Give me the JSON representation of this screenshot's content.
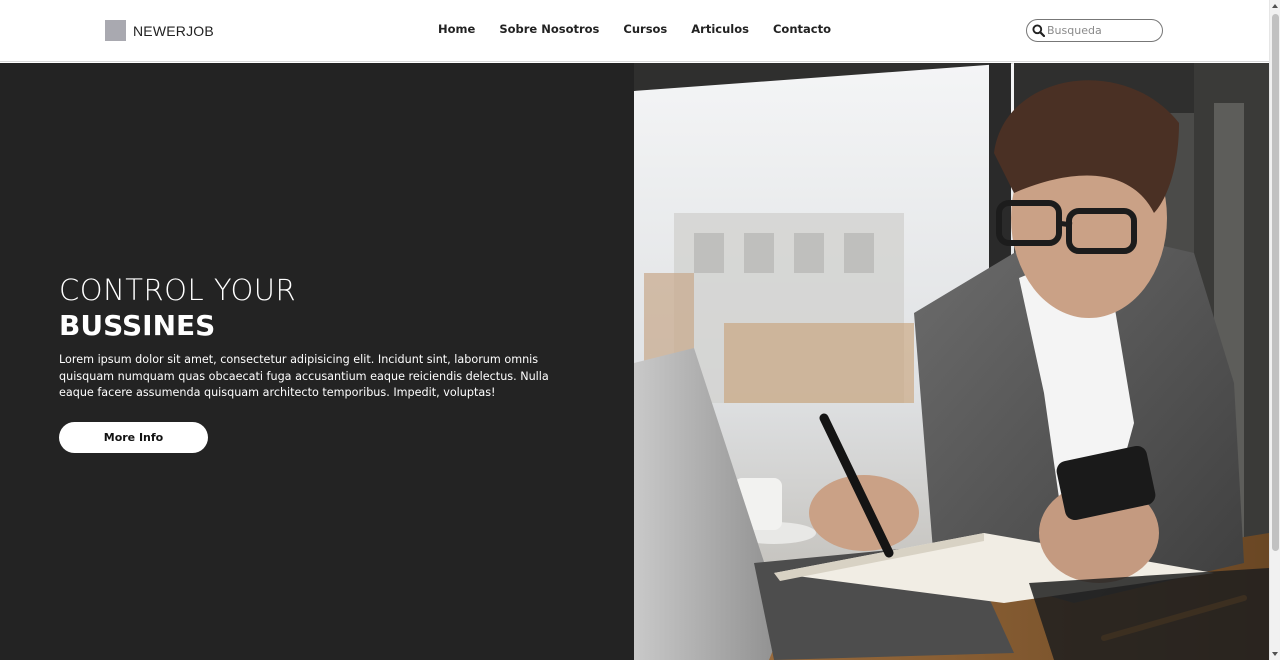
{
  "brand": {
    "name": "NEWERJOB"
  },
  "nav": {
    "items": [
      {
        "label": "Home"
      },
      {
        "label": "Sobre Nosotros"
      },
      {
        "label": "Cursos"
      },
      {
        "label": "Articulos"
      },
      {
        "label": "Contacto"
      }
    ]
  },
  "search": {
    "placeholder": "Busqueda",
    "value": ""
  },
  "hero": {
    "title_line1": "CONTROL YOUR",
    "title_line2": "BUSSINES",
    "text": "Lorem ipsum dolor sit amet, consectetur adipisicing elit. Incidunt sint, laborum omnis quisquam numquam quas obcaecati fuga accusantium eaque reiciendis delectus. Nulla eaque facere assumenda quisquam architecto temporibus. Impedit, voluptas!",
    "button_label": "More Info",
    "image": "man-with-phone-and-notebook-photo"
  },
  "colors": {
    "hero_background": "#232323",
    "brand_logo": "#a9a9b0",
    "button_background": "#ffffff"
  },
  "icons": {
    "search": "search-icon"
  }
}
